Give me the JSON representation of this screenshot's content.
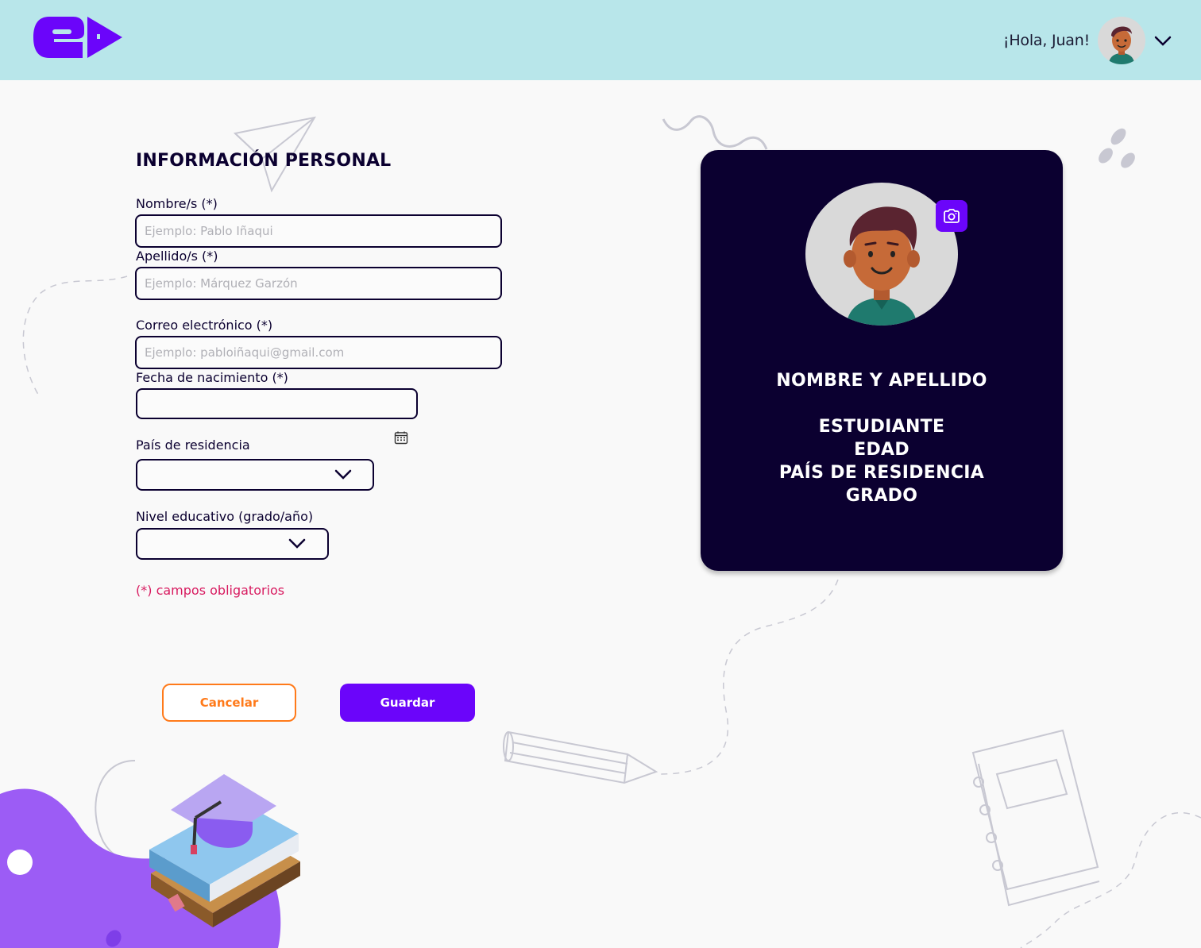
{
  "header": {
    "greeting": "¡Hola, Juan!",
    "logo_icon": "edu-logo-icon",
    "avatar_icon": "user-avatar-icon",
    "menu_icon": "chevron-down-icon",
    "background_color": "#b8e6ea",
    "logo_color": "#6b05fa"
  },
  "form": {
    "title": "INFORMACIÓN PERSONAL",
    "fields": {
      "nombre": {
        "label": "Nombre/s (*)",
        "placeholder": "Ejemplo: Pablo Iñaqui",
        "value": ""
      },
      "apellido": {
        "label": "Apellido/s (*)",
        "placeholder": "Ejemplo: Márquez Garzón",
        "value": ""
      },
      "correo": {
        "label": "Correo electrónico (*)",
        "placeholder": "Ejemplo: pabloiñaqui@gmail.com",
        "value": ""
      },
      "fecha": {
        "label": "Fecha de nacimiento (*)",
        "value": "",
        "icon": "calendar-icon"
      },
      "pais": {
        "label": "País de residencia",
        "selected": ""
      },
      "nivel": {
        "label": "Nivel educativo (grado/año)",
        "selected": ""
      }
    },
    "required_note": "(*) campos obligatorios",
    "buttons": {
      "cancel": "Cancelar",
      "save": "Guardar"
    }
  },
  "profile_card": {
    "name": "NOMBRE Y APELLIDO",
    "role": "ESTUDIANTE",
    "age": "EDAD",
    "country": "PAÍS DE RESIDENCIA",
    "grade": "GRADO",
    "avatar_icon": "student-avatar-icon",
    "camera_icon": "camera-icon",
    "background_color": "#0b0030"
  },
  "colors": {
    "accent": "#6b05fa",
    "cancel": "#ff7a1a",
    "required": "#d81b60",
    "text": "#0b0030"
  }
}
